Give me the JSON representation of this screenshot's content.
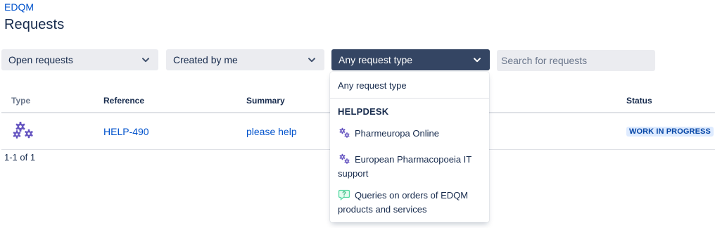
{
  "breadcrumb": "EDQM",
  "title": "Requests",
  "filters": {
    "status_select": "Open requests",
    "creator_select": "Created by me",
    "type_select": "Any request type",
    "search_placeholder": "Search for requests"
  },
  "table": {
    "headers": [
      "Type",
      "Reference",
      "Summary",
      "Status"
    ],
    "rows": [
      {
        "type_icon": "cogs-icon",
        "reference": "HELP-490",
        "summary": "please help",
        "status": "WORK IN PROGRESS"
      }
    ]
  },
  "pagination": "1-1 of 1",
  "dropdown": {
    "any_label": "Any request type",
    "group_label": "HELPDESK",
    "options": [
      {
        "label": "Pharmeuropa Online",
        "icon": "cogs-icon"
      },
      {
        "label": "European Pharmacopoeia IT support",
        "icon": "cogs-icon"
      },
      {
        "label": "Queries on orders of EDQM products and services",
        "icon": "question-chat-icon"
      }
    ]
  },
  "colors": {
    "link": "#0052cc",
    "active_select": "#344563",
    "badge_bg": "#deebff",
    "badge_text": "#0747a6",
    "cog_icon": "#6554c0",
    "question_icon": "#57d9a3"
  }
}
